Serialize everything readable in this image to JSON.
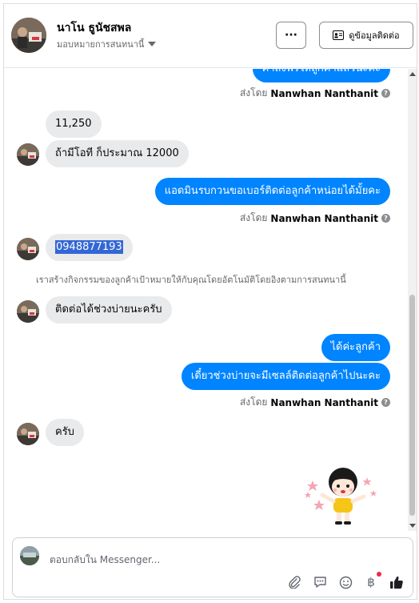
{
  "header": {
    "name": "นาโน ธูนัชสพล",
    "subtitle": "มอบหมายการสนทนานี้",
    "more_label": "···",
    "contact_button": "ดูข้อมูลติดต่อ"
  },
  "messages": {
    "top_partial": "ค่าส่งฟรีให้ลูกค้าแล้วนะคะ",
    "sent_by_prefix": "ส่งโดย",
    "sender": "Nanwhan Nanthanit",
    "in_1": "11,250",
    "in_2": "ถ้ามีโอที ก็ประมาณ 12000",
    "out_1": "แอดมินรบกวนขอเบอร์ติดต่อลูกค้าหน่อยได้มั้ยคะ",
    "in_phone": "0948877193",
    "system_note": "เราสร้างกิจกรรมของลูกค้าเป้าหมายให้กับคุณโดยอัตโนมัติโดยอิงตามการสนทนานี้",
    "in_3": "ติดต่อได้ช่วงบ่ายนะครับ",
    "out_2": "ได้ค่ะลูกค้า",
    "out_3": "เดี๋ยวช่วงบ่ายจะมีเซลล์ติดต่อลูกค้าไปนะคะ",
    "in_4": "ครับ"
  },
  "composer": {
    "placeholder": "ตอบกลับใน Messenger..."
  },
  "icons": [
    "attachment-icon",
    "saved-reply-icon",
    "emoji-icon",
    "baht-payment-icon",
    "like-icon"
  ],
  "colors": {
    "outgoing_bubble": "#0084ff",
    "incoming_bubble": "#e9eaeb",
    "like_icon": "#1c1e21",
    "notification_dot": "#f02849"
  }
}
